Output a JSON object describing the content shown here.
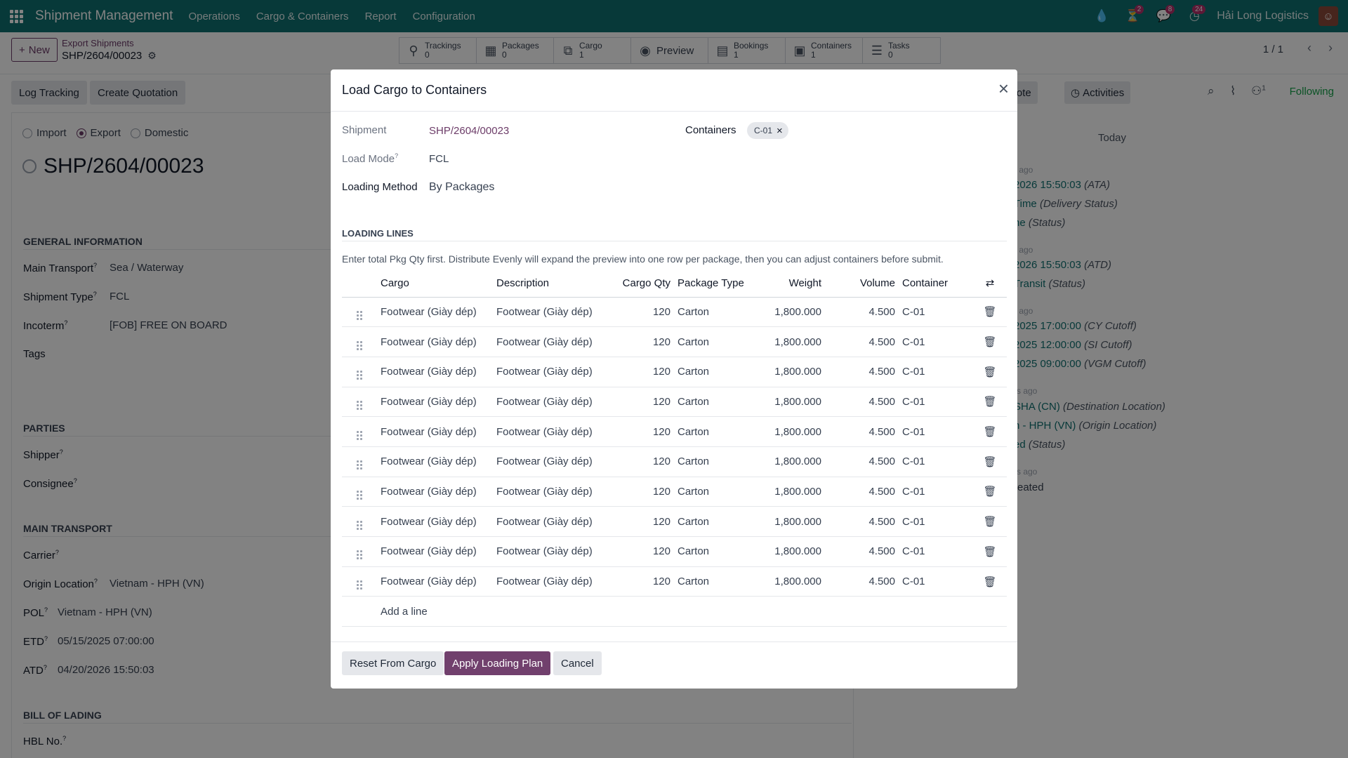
{
  "app": {
    "name": "Shipment Management",
    "menu": [
      "Operations",
      "Cargo & Containers",
      "Report",
      "Configuration"
    ],
    "company": "Hải Long Logistics",
    "badges": {
      "activity": "2",
      "messages": "8",
      "clock": "24"
    }
  },
  "control": {
    "new_label": "New",
    "breadcrumb_parent": "Export Shipments",
    "breadcrumb_current": "SHP/2604/00023",
    "pager": "1 / 1",
    "smart_buttons": [
      {
        "label": "Trackings",
        "count": "0",
        "icon": "map-marker-icon"
      },
      {
        "label": "Packages",
        "count": "0",
        "icon": "archive-icon"
      },
      {
        "label": "Cargo",
        "count": "1",
        "icon": "cubes-icon"
      },
      {
        "label": "Preview",
        "icon": "eye-icon"
      },
      {
        "label": "Bookings",
        "count": "1",
        "icon": "book-icon"
      },
      {
        "label": "Containers",
        "count": "1",
        "icon": "box-icon"
      },
      {
        "label": "Tasks",
        "count": "0",
        "icon": "tasks-icon"
      }
    ]
  },
  "form": {
    "actions": [
      "Log Tracking",
      "Create Quotation"
    ],
    "direction_options": [
      "Import",
      "Export",
      "Domestic"
    ],
    "direction_selected": "Export",
    "title": "SHP/2604/00023",
    "general_section": "GENERAL INFORMATION",
    "main_transport_label": "Main Transport",
    "main_transport": "Sea / Waterway",
    "shipment_type_label": "Shipment Type",
    "shipment_type": "FCL",
    "incoterm_label": "Incoterm",
    "incoterm": "[FOB] FREE ON BOARD",
    "tags_label": "Tags",
    "parties_section": "PARTIES",
    "shipper_label": "Shipper",
    "consignee_label": "Consignee",
    "main_transport_section": "MAIN TRANSPORT",
    "carrier_label": "Carrier",
    "origin_label": "Origin Location",
    "origin": "Vietnam - HPH (VN)",
    "pol_label": "POL",
    "pol": "Vietnam - HPH (VN)",
    "etd_label": "ETD",
    "etd": "05/15/2025 07:00:00",
    "atd_label": "ATD",
    "atd": "04/20/2026 15:50:03",
    "bol_section": "BILL OF LADING",
    "hbl_label": "HBL No."
  },
  "chatter": {
    "log_note": "g note",
    "activities": "Activities",
    "followers_count": "1",
    "following": "Following",
    "today": "Today",
    "lines": [
      {
        "small": "r ago"
      },
      {
        "link": "2026 15:50:03",
        "it": "(ATA)"
      },
      {
        "link": "Time",
        "it": "(Delivery Status)"
      },
      {
        "link": "ne",
        "it": "(Status)"
      },
      {
        "small": "r ago"
      },
      {
        "link": "2026 15:50:03",
        "it": "(ATD)"
      },
      {
        "link": "Transit",
        "it": "(Status)"
      },
      {
        "small": "r ago"
      },
      {
        "link": "2025 17:00:00",
        "it": "(CY Cutoff)"
      },
      {
        "link": "2025 12:00:00",
        "it": "(SI Cutoff)"
      },
      {
        "link": "2025 09:00:00",
        "it": "(VGM Cutoff)"
      },
      {
        "small": "rs ago"
      },
      {
        "link": "SHA (CN)",
        "it": "(Destination Location)"
      },
      {
        "link": "n - HPH (VN)",
        "it": "(Origin Location)"
      },
      {
        "link": "ed",
        "it": "(Status)"
      },
      {
        "small": "rs ago"
      },
      {
        "plain": "reated"
      }
    ]
  },
  "modal": {
    "title": "Load Cargo to Containers",
    "shipment_label": "Shipment",
    "shipment": "SHP/2604/00023",
    "load_mode_label": "Load Mode",
    "load_mode": "FCL",
    "loading_method_label": "Loading Method",
    "loading_method": "By Packages",
    "containers_label": "Containers",
    "container_tag": "C-01",
    "section": "LOADING LINES",
    "help": "Enter total Pkg Qty first. Distribute Evenly will expand the preview into one row per package, then you can adjust containers before submit.",
    "columns": {
      "cargo": "Cargo",
      "description": "Description",
      "qty": "Cargo Qty",
      "pkg": "Package Type",
      "weight": "Weight",
      "volume": "Volume",
      "container": "Container"
    },
    "rows": [
      {
        "cargo": "Footwear (Giày dép)",
        "description": "Footwear (Giày dép)",
        "qty": "120",
        "pkg": "Carton",
        "weight": "1,800.000",
        "volume": "4.500",
        "container": "C-01"
      },
      {
        "cargo": "Footwear (Giày dép)",
        "description": "Footwear (Giày dép)",
        "qty": "120",
        "pkg": "Carton",
        "weight": "1,800.000",
        "volume": "4.500",
        "container": "C-01"
      },
      {
        "cargo": "Footwear (Giày dép)",
        "description": "Footwear (Giày dép)",
        "qty": "120",
        "pkg": "Carton",
        "weight": "1,800.000",
        "volume": "4.500",
        "container": "C-01"
      },
      {
        "cargo": "Footwear (Giày dép)",
        "description": "Footwear (Giày dép)",
        "qty": "120",
        "pkg": "Carton",
        "weight": "1,800.000",
        "volume": "4.500",
        "container": "C-01"
      },
      {
        "cargo": "Footwear (Giày dép)",
        "description": "Footwear (Giày dép)",
        "qty": "120",
        "pkg": "Carton",
        "weight": "1,800.000",
        "volume": "4.500",
        "container": "C-01"
      },
      {
        "cargo": "Footwear (Giày dép)",
        "description": "Footwear (Giày dép)",
        "qty": "120",
        "pkg": "Carton",
        "weight": "1,800.000",
        "volume": "4.500",
        "container": "C-01"
      },
      {
        "cargo": "Footwear (Giày dép)",
        "description": "Footwear (Giày dép)",
        "qty": "120",
        "pkg": "Carton",
        "weight": "1,800.000",
        "volume": "4.500",
        "container": "C-01"
      },
      {
        "cargo": "Footwear (Giày dép)",
        "description": "Footwear (Giày dép)",
        "qty": "120",
        "pkg": "Carton",
        "weight": "1,800.000",
        "volume": "4.500",
        "container": "C-01"
      },
      {
        "cargo": "Footwear (Giày dép)",
        "description": "Footwear (Giày dép)",
        "qty": "120",
        "pkg": "Carton",
        "weight": "1,800.000",
        "volume": "4.500",
        "container": "C-01"
      },
      {
        "cargo": "Footwear (Giày dép)",
        "description": "Footwear (Giày dép)",
        "qty": "120",
        "pkg": "Carton",
        "weight": "1,800.000",
        "volume": "4.500",
        "container": "C-01"
      }
    ],
    "add_line": "Add a line",
    "buttons": {
      "reset": "Reset From Cargo",
      "apply": "Apply Loading Plan",
      "cancel": "Cancel"
    }
  },
  "colors": {
    "navbar": "#0f7070",
    "primary": "#71406d",
    "link": "#6c3c68",
    "following": "#16a34a"
  }
}
